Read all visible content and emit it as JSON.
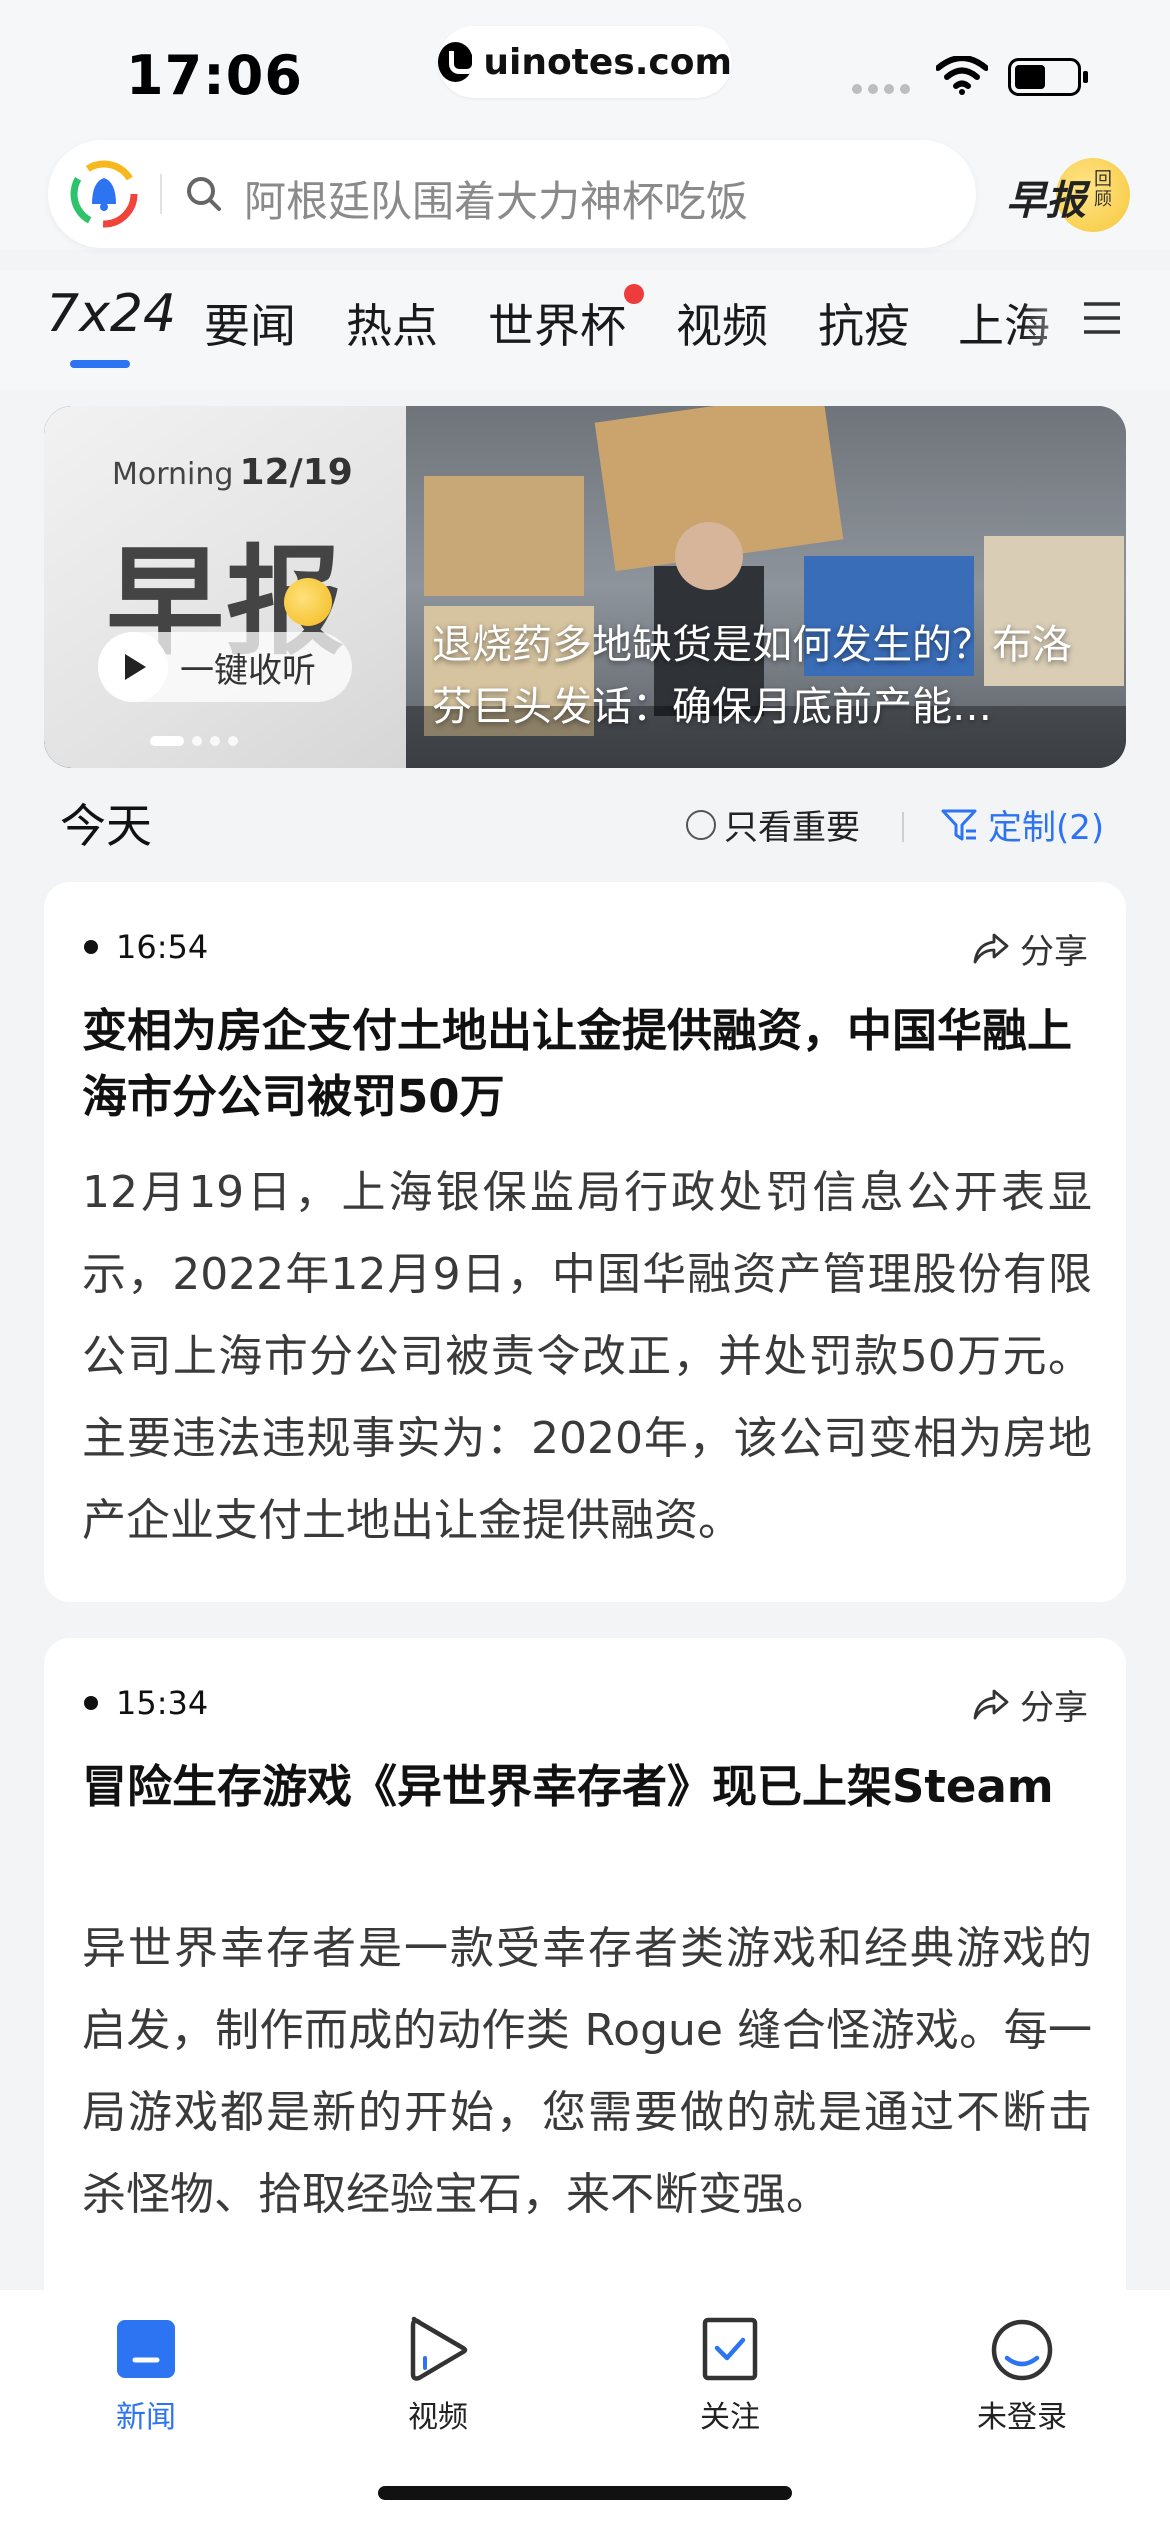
{
  "status_bar": {
    "time": "17:06",
    "url": "uinotes.com"
  },
  "header": {
    "search_placeholder": "阿根廷队围着大力神杯吃饭",
    "badge_big": "早报",
    "badge_small": "回顾"
  },
  "tabs": [
    {
      "label": "7x24",
      "active": true
    },
    {
      "label": "要闻"
    },
    {
      "label": "热点"
    },
    {
      "label": "世界杯",
      "badge": "red-dot"
    },
    {
      "label": "视频"
    },
    {
      "label": "抗疫"
    },
    {
      "label": "上海"
    }
  ],
  "banner": {
    "morning": "Morning",
    "date": "12/19",
    "title": "早报",
    "listen_label": "一键收听",
    "caption": "退烧药多地缺货是如何发生的？布洛芬巨头发话：确保月底前产能…",
    "slide_count": 4,
    "active_slide": 1
  },
  "section": {
    "title": "今天",
    "filter_important": "只看重要",
    "customize": "定制(2)"
  },
  "news": [
    {
      "time": "16:54",
      "share": "分享",
      "title": "变相为房企支付土地出让金提供融资，中国华融上海市分公司被罚50万",
      "body": "12月19日，上海银保监局行政处罚信息公开表显示，2022年12月9日，中国华融资产管理股份有限公司上海市分公司被责令改正，并处罚款50万元。主要违法违规事实为：2020年，该公司变相为房地产企业支付土地出让金提供融资。"
    },
    {
      "time": "15:34",
      "share": "分享",
      "title": "冒险生存游戏《异世界幸存者》现已上架Steam",
      "body": "异世界幸存者是一款受幸存者类游戏和经典游戏的启发，制作而成的动作类 Rogue 缝合怪游戏。每一局游戏都是新的开始，您需要做的就是通过不断击杀怪物、拾取经验宝石，来不断变强。"
    }
  ],
  "bottom_nav": [
    {
      "label": "新闻",
      "icon": "news-icon",
      "active": true
    },
    {
      "label": "视频",
      "icon": "video-play-icon"
    },
    {
      "label": "关注",
      "icon": "follow-icon"
    },
    {
      "label": "未登录",
      "icon": "profile-icon"
    }
  ],
  "colors": {
    "accent": "#2d74f2",
    "badge_red": "#ee3b3b",
    "background": "#f3f4f6"
  }
}
